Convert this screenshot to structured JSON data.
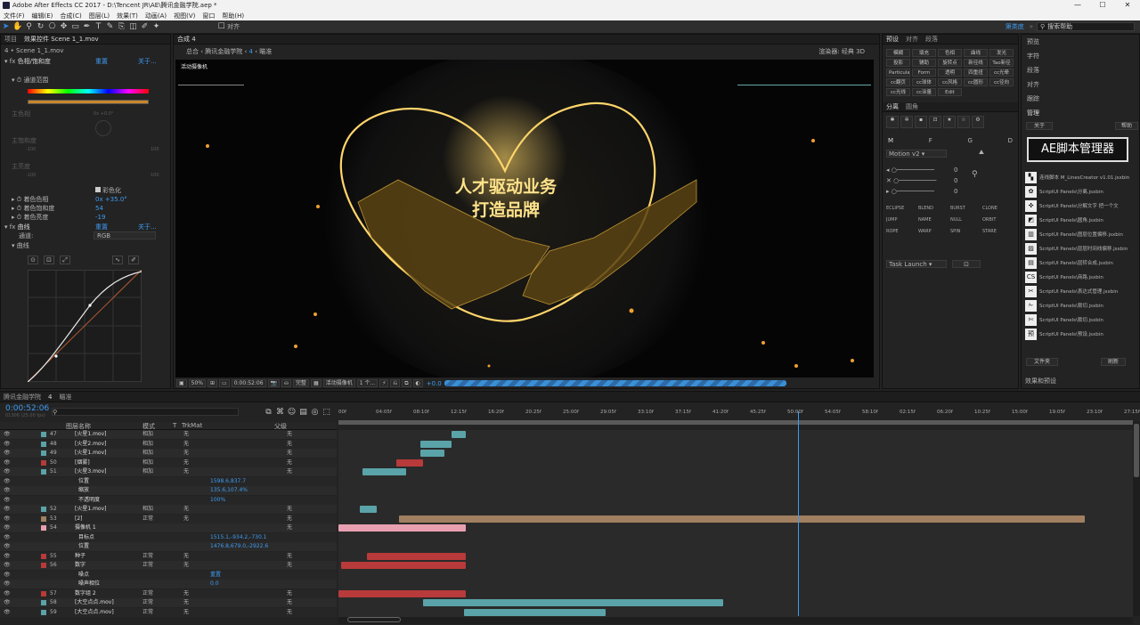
{
  "app": {
    "title": "Adobe After Effects CC 2017 - D:\\Tencent JR\\AE\\腾讯金融学院.aep *"
  },
  "window_controls": [
    "—",
    "☐",
    "✕"
  ],
  "menu": [
    "文件(F)",
    "编辑(E)",
    "合成(C)",
    "图层(L)",
    "效果(T)",
    "动画(A)",
    "视图(V)",
    "窗口",
    "帮助(H)"
  ],
  "toolbar": {
    "snap_label": "对齐",
    "workspace": "第类底",
    "search_placeholder": "搜索帮助"
  },
  "left_panel": {
    "tabs": [
      "项目",
      "效果控件 Scene 1_1.mov"
    ],
    "path": "4 • Scene 1_1.mov",
    "fx1": {
      "name": "色相/饱和度",
      "reset": "重置",
      "about": "关于..."
    },
    "channel_range": "通道范围",
    "hue_label": "主色相",
    "sat_label": "主饱和度",
    "light_label": "主亮度",
    "hue_val": "0x +0.0°",
    "sat_min": "-100",
    "sat_max": "100",
    "light_min": "-100",
    "light_max": "100",
    "zero": "0",
    "colorize": "彩色化",
    "colorize_hue": {
      "label": "着色色相",
      "value": "0x +35.0°"
    },
    "colorize_sat": {
      "label": "着色饱和度",
      "value": "54"
    },
    "colorize_light": {
      "label": "着色亮度",
      "value": "-19"
    },
    "fx2": {
      "name": "曲线",
      "reset": "重置",
      "about": "关于..."
    },
    "channel": {
      "label": "通道:",
      "value": "RGB"
    },
    "curves_label": "曲线"
  },
  "comp": {
    "tabs": [
      "合成 4"
    ],
    "breadcrumb": [
      "总合",
      "腾讯金融学院",
      "4",
      "瞄准"
    ],
    "renderer": "渲染器:  经典 3D",
    "camera_label": "活动摄像机",
    "headline1": "人才驱动业务",
    "headline2": "打造品牌",
    "zoom": "50%",
    "time": "0:00:52:06",
    "quality": "完整",
    "view": "活动摄像机",
    "views": "1 个...",
    "exposure": "+0.0"
  },
  "effects_panel": {
    "tabs": [
      "预设",
      "对齐",
      "段落"
    ],
    "buttons": [
      "模糊",
      "填充",
      "色相",
      "曲线",
      "发光",
      "投影",
      "辅助",
      "旋转点",
      "新径线",
      "Tao新径",
      "Particular",
      "Form",
      "透明",
      "四重扭曲",
      "cc光晕风",
      "cc翻页",
      "cc球体",
      "cc风格化",
      "cc圆形",
      "cc径向",
      "cc光线",
      "cc涂量开",
      "Edit"
    ],
    "subtabs": [
      "分离",
      "圆角"
    ],
    "mode_tabs": [
      "M",
      "F",
      "G",
      "D"
    ],
    "motion": "Motion v2",
    "sliders": [
      "0",
      "0",
      "0"
    ],
    "anim_buttons": [
      "ECLIPSE",
      "BLEND",
      "BURST",
      "CLONE",
      "JUMP",
      "NAME",
      "NULL",
      "ORBIT",
      "ROPE",
      "WARP",
      "SPIN",
      "STARE"
    ],
    "task": "Task Launch"
  },
  "right_panel": {
    "items": [
      "预览",
      "字符",
      "段落",
      "对齐",
      "跟踪"
    ],
    "manager_title": "管理",
    "about_btn": "关于",
    "help_btn": "帮助",
    "ae_title": "AE脚本管理器",
    "scripts": [
      "连线脚本 M_LinesCreator v1.01.jsxbin",
      "ScriptUI Panels\\分离.jsxbin",
      "ScriptUI Panels\\分解文字 把一个文",
      "ScriptUI Panels\\圆角.jsxbin",
      "ScriptUI Panels\\图层位置偏移.jsxbin",
      "ScriptUI Panels\\层层时间线偏移.jsxbin",
      "ScriptUI Panels\\层转合成.jsxbin",
      "ScriptUI Panels\\商路.jsxbin",
      "ScriptUI Panels\\表达式管理.jsxbin",
      "ScriptUI Panels\\裁切.jsxbin",
      "ScriptUI Panels\\裁切.jsxbin",
      "ScriptUI Panels\\预设.jsxbin"
    ],
    "file_btn": "文件夹",
    "refresh_btn": "刷新",
    "effects_presets": "效果和预设"
  },
  "timeline": {
    "tabs": [
      "腾讯金融学院",
      "4",
      "瞄准"
    ],
    "timecode": "0:00:52:06",
    "frame_info": "01306 (25.00 fps)",
    "col_headers": [
      "图层名称",
      "模式",
      "T",
      "TrkMat",
      "父级"
    ],
    "ruler": [
      "00f",
      "04:05f",
      "08:10f",
      "12:15f",
      "16:20f",
      "20:25f",
      "25:00f",
      "29:05f",
      "33:10f",
      "37:15f",
      "41:20f",
      "45:25f",
      "50:00f",
      "54:05f",
      "58:10f",
      "02:15f",
      "06:20f",
      "10:25f",
      "15:00f",
      "19:05f",
      "23:10f",
      "27:15f"
    ],
    "layers": [
      {
        "num": "47",
        "name": "[火星1.mov]",
        "mode": "相加",
        "trk": "无",
        "parent": "无",
        "color": "#5aa3a8"
      },
      {
        "num": "48",
        "name": "[火星2.mov]",
        "mode": "相加",
        "trk": "无",
        "parent": "无",
        "color": "#5aa3a8"
      },
      {
        "num": "49",
        "name": "[火星1.mov]",
        "mode": "相加",
        "trk": "无",
        "parent": "无",
        "color": "#5aa3a8"
      },
      {
        "num": "50",
        "name": "[烟雾]",
        "mode": "相加",
        "trk": "无",
        "parent": "无",
        "color": "#b83a3a"
      },
      {
        "num": "51",
        "name": "[火星3.mov]",
        "mode": "相加",
        "trk": "无",
        "parent": "无",
        "color": "#5aa3a8"
      },
      {
        "num": "",
        "name": "位置",
        "value": "1598.6,837.7",
        "color": ""
      },
      {
        "num": "",
        "name": "缩放",
        "value": "135.6,107.4%",
        "color": ""
      },
      {
        "num": "",
        "name": "不透明度",
        "value": "100%",
        "color": ""
      },
      {
        "num": "52",
        "name": "[火星1.mov]",
        "mode": "相加",
        "trk": "无",
        "parent": "无",
        "color": "#5aa3a8"
      },
      {
        "num": "53",
        "name": "[2]",
        "mode": "正常",
        "trk": "无",
        "parent": "无",
        "color": "#a08060"
      },
      {
        "num": "54",
        "name": "摄像机 1",
        "mode": "",
        "trk": "",
        "parent": "无",
        "color": "#e8a0b0"
      },
      {
        "num": "",
        "name": "目标点",
        "value": "1515.1,-934.2,-730.1",
        "color": ""
      },
      {
        "num": "",
        "name": "位置",
        "value": "1476.8,679.0,-2922.6",
        "color": ""
      },
      {
        "num": "55",
        "name": "种子",
        "mode": "正常",
        "trk": "无",
        "parent": "无",
        "color": "#b83a3a"
      },
      {
        "num": "56",
        "name": "数字",
        "mode": "正常",
        "trk": "无",
        "parent": "无",
        "color": "#b83a3a"
      },
      {
        "num": "",
        "name": "噪点",
        "value": "重置",
        "color": ""
      },
      {
        "num": "",
        "name": "噪声相位",
        "value": "0.0",
        "color": ""
      },
      {
        "num": "57",
        "name": "数字组 2",
        "mode": "正常",
        "trk": "无",
        "parent": "无",
        "color": "#b83a3a"
      },
      {
        "num": "58",
        "name": "[大空点点.mov]",
        "mode": "正常",
        "trk": "无",
        "parent": "无",
        "color": "#5aa3a8"
      },
      {
        "num": "59",
        "name": "[大空点点.mov]",
        "mode": "正常",
        "trk": "无",
        "parent": "无",
        "color": "#5aa3a8"
      }
    ],
    "bars": [
      {
        "row": 0,
        "start": 4.7,
        "end": 5.3,
        "color": "#5aa3a8"
      },
      {
        "row": 1,
        "start": 3.4,
        "end": 4.7,
        "color": "#5aa3a8"
      },
      {
        "row": 2,
        "start": 3.4,
        "end": 4.4,
        "color": "#5aa3a8"
      },
      {
        "row": 3,
        "start": 2.4,
        "end": 3.5,
        "color": "#b83a3a"
      },
      {
        "row": 4,
        "start": 1.0,
        "end": 2.8,
        "color": "#5aa3a8"
      },
      {
        "row": 8,
        "start": 0.9,
        "end": 1.6,
        "color": "#5aa3a8"
      },
      {
        "row": 9,
        "start": 2.5,
        "end": 31.0,
        "color": "#a08060"
      },
      {
        "row": 10,
        "start": 0.0,
        "end": 5.3,
        "color": "#e8a0b0"
      },
      {
        "row": 13,
        "start": 1.2,
        "end": 5.3,
        "color": "#b83a3a"
      },
      {
        "row": 14,
        "start": 0.1,
        "end": 5.3,
        "color": "#b83a3a"
      },
      {
        "row": 17,
        "start": 0.0,
        "end": 5.3,
        "color": "#b83a3a"
      },
      {
        "row": 18,
        "start": 3.5,
        "end": 16.0,
        "color": "#5aa3a8"
      },
      {
        "row": 19,
        "start": 5.2,
        "end": 11.1,
        "color": "#5aa3a8"
      }
    ],
    "playhead_fraction": 0.578
  }
}
